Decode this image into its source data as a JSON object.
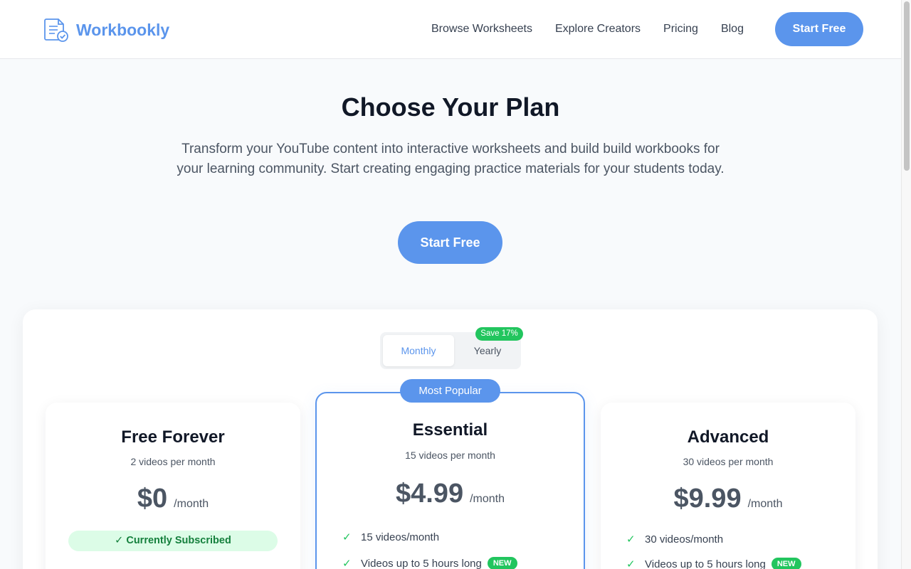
{
  "header": {
    "brand": "Workbookly",
    "nav": [
      "Browse Worksheets",
      "Explore Creators",
      "Pricing",
      "Blog"
    ],
    "cta_label": "Start Free"
  },
  "hero": {
    "title": "Choose Your Plan",
    "subtitle": "Transform your YouTube content into interactive worksheets and build build workbooks for your learning community. Start creating engaging practice materials for your students today.",
    "cta_label": "Start Free"
  },
  "billing": {
    "monthly_label": "Monthly",
    "yearly_label": "Yearly",
    "selected": "Monthly",
    "save_badge": "Save 17%"
  },
  "plans": [
    {
      "title": "Free Forever",
      "subtitle": "2 videos per month",
      "price": "$0",
      "period": "/month",
      "status": "✓ Currently Subscribed",
      "features": []
    },
    {
      "title": "Essential",
      "subtitle": "15 videos per month",
      "price": "$4.99",
      "period": "/month",
      "badge": "Most Popular",
      "features": [
        {
          "text": "15 videos/month",
          "badge": ""
        },
        {
          "text": "Videos up to 5 hours long",
          "badge": "NEW"
        }
      ]
    },
    {
      "title": "Advanced",
      "subtitle": "30 videos per month",
      "price": "$9.99",
      "period": "/month",
      "features": [
        {
          "text": "30 videos/month",
          "badge": ""
        },
        {
          "text": "Videos up to 5 hours long",
          "badge": "NEW"
        }
      ]
    }
  ],
  "colors": {
    "accent": "#5b95ec",
    "success": "#22c55e",
    "success_bg": "#dcfce7"
  },
  "icons": {
    "logo": "document-check-icon",
    "feature": "check-icon"
  }
}
